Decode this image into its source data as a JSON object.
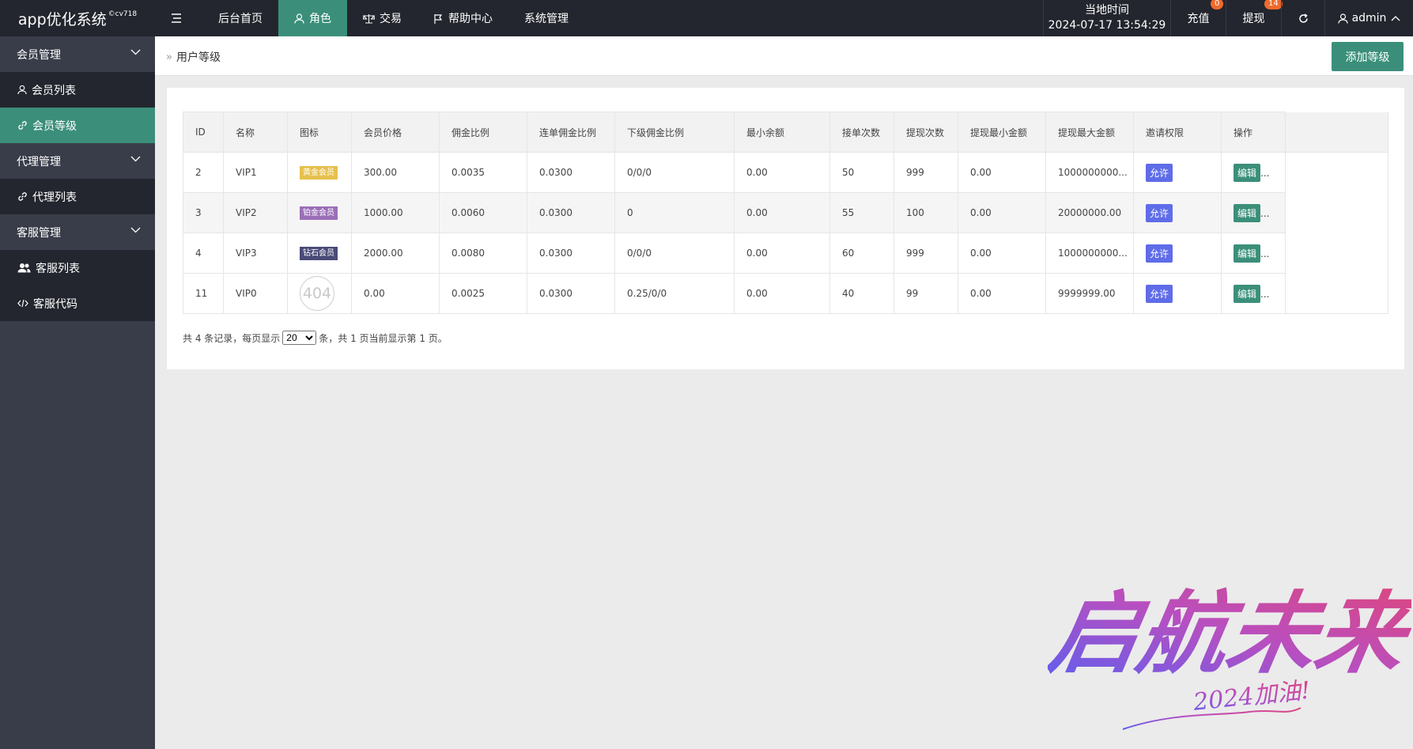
{
  "header": {
    "logo": "app优化系统",
    "logo_sup": "©cv718",
    "nav": [
      {
        "label": "",
        "icon": "menu-icon"
      },
      {
        "label": "后台首页"
      },
      {
        "label": "角色",
        "icon": "user-icon",
        "active": true
      },
      {
        "label": "交易",
        "icon": "scale-icon"
      },
      {
        "label": "帮助中心",
        "icon": "flag-icon"
      },
      {
        "label": "系统管理"
      }
    ],
    "clock_label": "当地时间",
    "clock_value": "2024-07-17 13:54:29",
    "recharge": {
      "label": "充值",
      "badge": "0"
    },
    "withdraw": {
      "label": "提现",
      "badge": "14"
    },
    "user": "admin"
  },
  "sidebar": {
    "items": [
      {
        "label": "会员管理",
        "type": "group"
      },
      {
        "label": "会员列表",
        "type": "sub",
        "icon": "user-icon"
      },
      {
        "label": "会员等级",
        "type": "sub",
        "icon": "link-icon",
        "active": true
      },
      {
        "label": "代理管理",
        "type": "group"
      },
      {
        "label": "代理列表",
        "type": "sub",
        "icon": "link-icon"
      },
      {
        "label": "客服管理",
        "type": "group"
      },
      {
        "label": "客服列表",
        "type": "sub",
        "icon": "users-icon"
      },
      {
        "label": "客服代码",
        "type": "sub",
        "icon": "code-icon"
      }
    ]
  },
  "page": {
    "breadcrumb": "用户等级",
    "add_button": "添加等级"
  },
  "table": {
    "headers": [
      "ID",
      "名称",
      "图标",
      "会员价格",
      "佣金比例",
      "连单佣金比例",
      "下级佣金比例",
      "最小余额",
      "接单次数",
      "提现次数",
      "提现最小金额",
      "提现最大金额",
      "邀请权限",
      "操作"
    ],
    "rows": [
      {
        "id": "2",
        "name": "VIP1",
        "tag": "黄金会员",
        "price": "300.00",
        "rate": "0.0035",
        "chain_rate": "0.0300",
        "sub_rate": "0/0/0",
        "min_balance": "0.00",
        "orders": "50",
        "withdraw_times": "999",
        "withdraw_min": "0.00",
        "withdraw_max": "1000000000...",
        "invite": "允许",
        "action": "编辑"
      },
      {
        "id": "3",
        "name": "VIP2",
        "tag": "铂金会员",
        "price": "1000.00",
        "rate": "0.0060",
        "chain_rate": "0.0300",
        "sub_rate": "0",
        "min_balance": "0.00",
        "orders": "55",
        "withdraw_times": "100",
        "withdraw_min": "0.00",
        "withdraw_max": "20000000.00",
        "invite": "允许",
        "action": "编辑"
      },
      {
        "id": "4",
        "name": "VIP3",
        "tag": "钻石会员",
        "price": "2000.00",
        "rate": "0.0080",
        "chain_rate": "0.0300",
        "sub_rate": "0/0/0",
        "min_balance": "0.00",
        "orders": "60",
        "withdraw_times": "999",
        "withdraw_min": "0.00",
        "withdraw_max": "1000000000...",
        "invite": "允许",
        "action": "编辑"
      },
      {
        "id": "11",
        "name": "VIP0",
        "tag": "404",
        "price": "0.00",
        "rate": "0.0025",
        "chain_rate": "0.0300",
        "sub_rate": "0.25/0/0",
        "min_balance": "0.00",
        "orders": "40",
        "withdraw_times": "99",
        "withdraw_min": "0.00",
        "withdraw_max": "9999999.00",
        "invite": "允许",
        "action": "编辑"
      }
    ],
    "ellipsis": "..."
  },
  "pager": {
    "prefix": "共 4 条记录，每页显示",
    "page_size": "20",
    "suffix": "条，共 1 页当前显示第 1 页。"
  },
  "watermark": {
    "main": "启航未来",
    "sub": "2024加油!"
  },
  "colors": {
    "header_bg": "#23262e",
    "sidebar_bg": "#393d49",
    "accent": "#3b8f7a",
    "badge": "#f06a2c",
    "allow": "#5f6ce8"
  }
}
